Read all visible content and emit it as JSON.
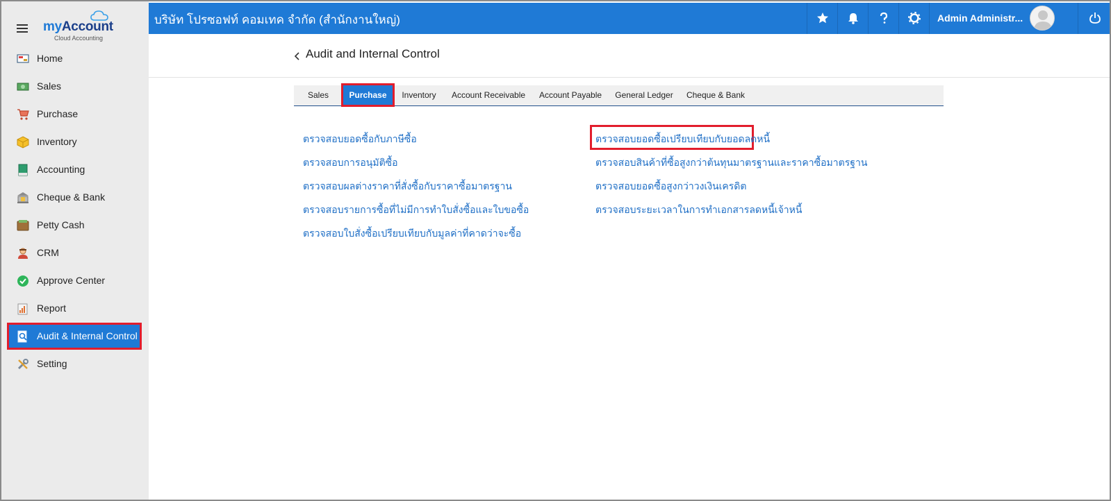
{
  "app": {
    "logo_prefix": "my",
    "logo_main": "Account",
    "logo_sub": "Cloud Accounting"
  },
  "topbar": {
    "company": "บริษัท โปรซอฟท์ คอมเทค จำกัด (สำนักงานใหญ่)",
    "user_name": "Admin Administr...",
    "accent": "#1f7ad6"
  },
  "sidebar": {
    "items": [
      {
        "label": "Home",
        "icon": "home-icon"
      },
      {
        "label": "Sales",
        "icon": "cash-icon"
      },
      {
        "label": "Purchase",
        "icon": "cart-icon"
      },
      {
        "label": "Inventory",
        "icon": "box-icon"
      },
      {
        "label": "Accounting",
        "icon": "book-icon"
      },
      {
        "label": "Cheque & Bank",
        "icon": "bank-icon"
      },
      {
        "label": "Petty Cash",
        "icon": "wallet-icon"
      },
      {
        "label": "CRM",
        "icon": "people-icon"
      },
      {
        "label": "Approve Center",
        "icon": "check-circle-icon"
      },
      {
        "label": "Report",
        "icon": "report-icon"
      },
      {
        "label": "Audit & Internal Control",
        "icon": "audit-icon"
      },
      {
        "label": "Setting",
        "icon": "tools-icon"
      }
    ],
    "active_index": 10
  },
  "page": {
    "title": "Audit and Internal Control"
  },
  "tabs": [
    {
      "label": "Sales"
    },
    {
      "label": "Purchase"
    },
    {
      "label": "Inventory"
    },
    {
      "label": "Account Receivable"
    },
    {
      "label": "Account Payable"
    },
    {
      "label": "General Ledger"
    },
    {
      "label": "Cheque & Bank"
    }
  ],
  "active_tab": "Purchase",
  "links_left": [
    "ตรวจสอบยอดซื้อกับภาษีซื้อ",
    "ตรวจสอบการอนุมัติซื้อ",
    "ตรวจสอบผลต่างราคาที่สั่งซื้อกับราคาซื้อมาตรฐาน",
    "ตรวจสอบรายการซื้อที่ไม่มีการทำใบสั่งซื้อและใบขอซื้อ",
    "ตรวจสอบใบสั่งซื้อเปรียบเทียบกับมูลค่าที่คาดว่าจะซื้อ"
  ],
  "links_right": [
    "ตรวจสอบยอดซื้อเปรียบเทียบกับยอดลดหนี้",
    "ตรวจสอบสินค้าที่ซื้อสูงกว่าต้นทุนมาตรฐานและราคาซื้อมาตรฐาน",
    "ตรวจสอบยอดซื้อสูงกว่าวงเงินเครดิต",
    "ตรวจสอบระยะเวลาในการทำเอกสารลดหนี้เจ้าหนี้"
  ]
}
